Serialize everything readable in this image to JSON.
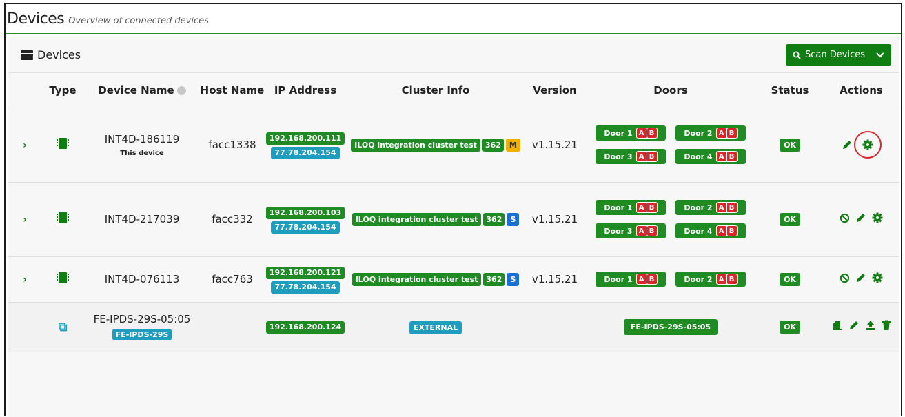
{
  "header": {
    "title": "Devices",
    "subtitle": "Overview of connected devices"
  },
  "panel": {
    "title": "Devices",
    "scan_label": "Scan Devices"
  },
  "table": {
    "columns": [
      "Type",
      "Device Name",
      "Host Name",
      "IP Address",
      "Cluster Info",
      "Version",
      "Doors",
      "Status",
      "Actions"
    ],
    "rows": [
      {
        "device_name": "INT4D-186119",
        "device_sub": "This device",
        "host": "facc1338",
        "ip1": "192.168.200.111",
        "ip2": "77.78.204.154",
        "cluster": "ILOQ integration cluster test",
        "cluster_num": "362",
        "cluster_role": "M",
        "version": "v1.15.21",
        "doors": [
          "Door 1",
          "Door 2",
          "Door 3",
          "Door 4"
        ],
        "status": "OK"
      },
      {
        "device_name": "INT4D-217039",
        "host": "facc332",
        "ip1": "192.168.200.103",
        "ip2": "77.78.204.154",
        "cluster": "ILOQ integration cluster test",
        "cluster_num": "362",
        "cluster_role": "S",
        "version": "v1.15.21",
        "doors": [
          "Door 1",
          "Door 2",
          "Door 3",
          "Door 4"
        ],
        "status": "OK"
      },
      {
        "device_name": "INT4D-076113",
        "host": "facc763",
        "ip1": "192.168.200.121",
        "ip2": "77.78.204.154",
        "cluster": "ILOQ integration cluster test",
        "cluster_num": "362",
        "cluster_role": "S",
        "version": "v1.15.21",
        "doors": [
          "Door 1",
          "Door 2"
        ],
        "status": "OK"
      },
      {
        "device_name": "FE-IPDS-29S-05:05",
        "device_badge": "FE-IPDS-29S",
        "ip1": "192.168.200.124",
        "cluster": "EXTERNAL",
        "door": "FE-IPDS-29S-05:05",
        "status": "OK"
      }
    ]
  },
  "door_lock_labels": {
    "a": "A",
    "b": "B"
  },
  "colors": {
    "accent": "#1e8c23",
    "info": "#1f9dbc",
    "master": "#f0b000",
    "slave": "#1a6fd6",
    "lock": "#d9262d",
    "highlight": "#d9262d"
  },
  "icons": [
    "server-icon",
    "search-icon",
    "chevron-down-icon",
    "chevron-right-icon",
    "chip-icon",
    "external-link-icon",
    "info-icon",
    "ban-icon",
    "pencil-icon",
    "gear-icon",
    "door-open-icon",
    "upload-icon",
    "trash-icon"
  ]
}
